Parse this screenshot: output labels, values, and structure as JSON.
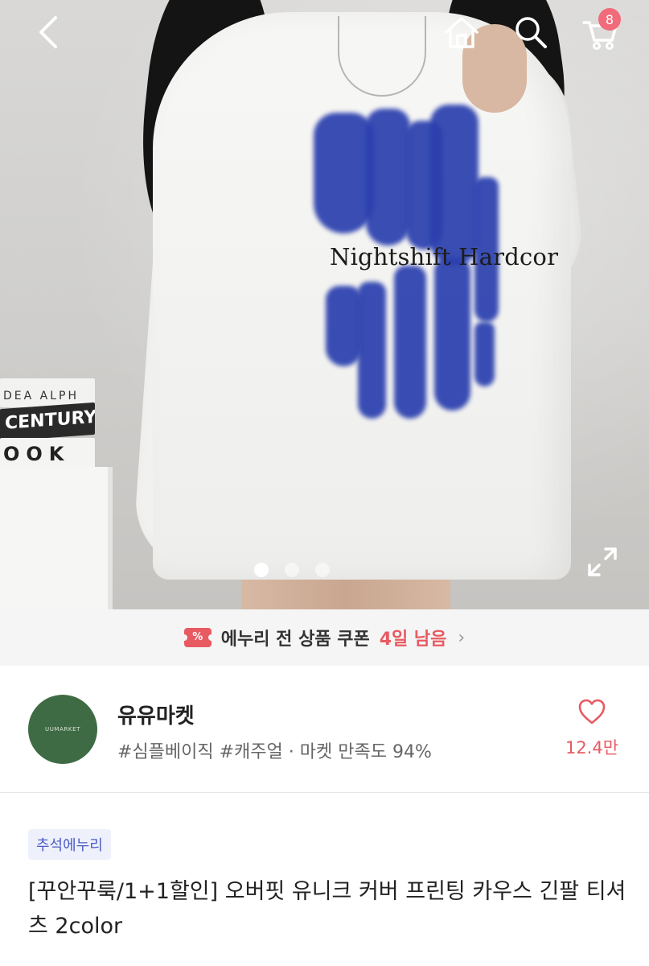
{
  "nav": {
    "back_icon": "chevron-left-icon",
    "home_icon": "home-icon",
    "search_icon": "search-icon",
    "cart_icon": "cart-icon",
    "cart_count": "8"
  },
  "hero": {
    "print_text": "Nightshift Hardcor",
    "books": [
      "DEA ALPH",
      "CENTURY",
      "OOK"
    ],
    "slide_count": 3,
    "active_slide": 1,
    "expand_icon": "expand-icon"
  },
  "coupon": {
    "icon_label": "%",
    "text": "에누리 전 상품 쿠폰",
    "highlight": "4일 남음",
    "chevron": "›"
  },
  "store": {
    "logo_text": "UUMARKET",
    "name": "유유마켓",
    "tags": "#심플베이직 #캐주얼 · 마켓 만족도 94%",
    "favorite_count": "12.4만"
  },
  "product": {
    "badge": "추석에누리",
    "title": "[꾸안꾸룩/1+1할인] 오버핏 유니크 커버 프린팅 카우스 긴팔 티셔츠 2color"
  },
  "colors": {
    "accent": "#e85a62",
    "badge_text": "#4b5cc4",
    "badge_bg": "#eef0fb",
    "store_logo_bg": "#3e6b44"
  }
}
